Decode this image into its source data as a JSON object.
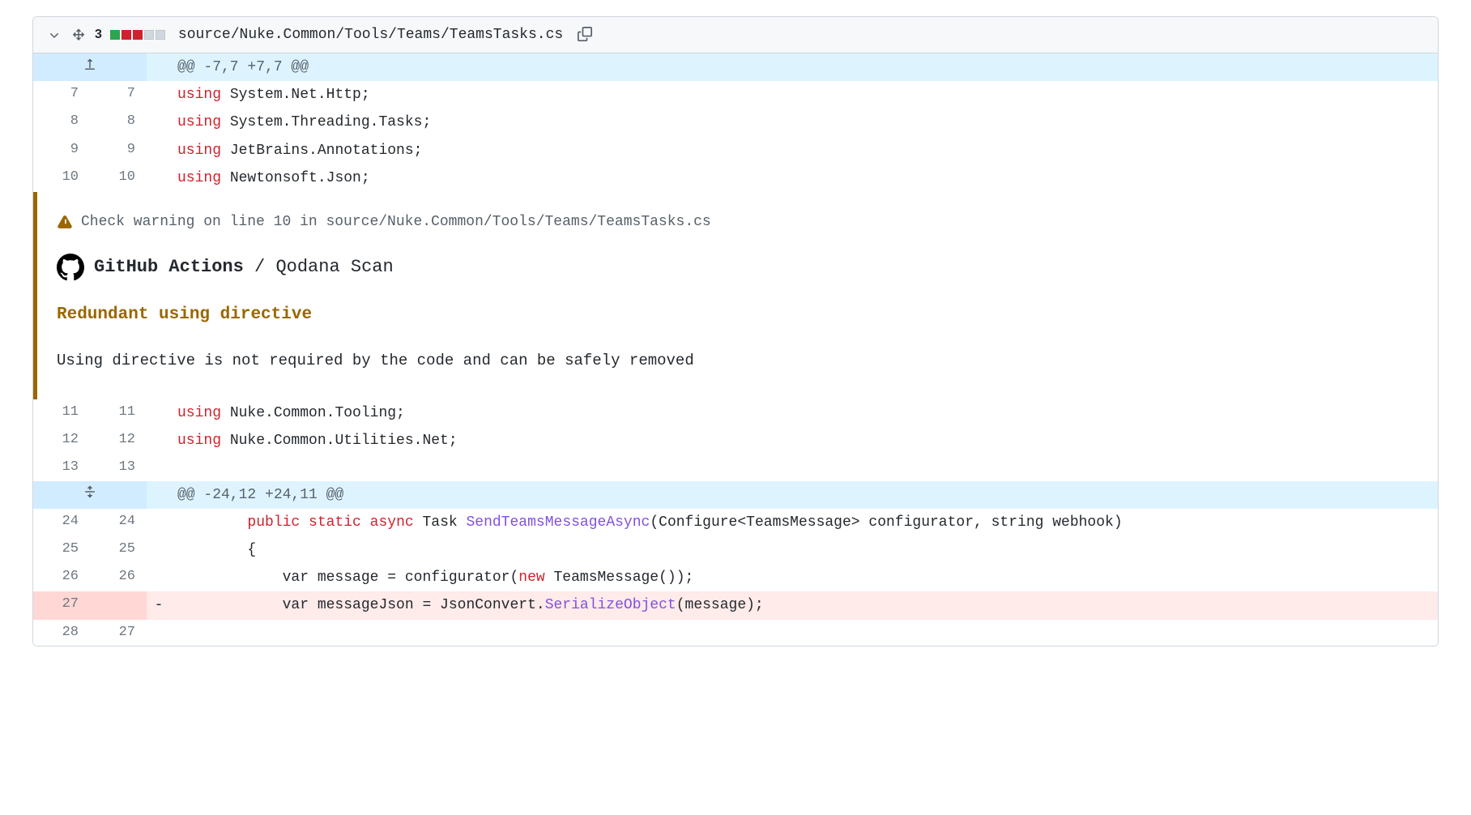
{
  "file": {
    "change_count": "3",
    "path": "source/Nuke.Common/Tools/Teams/TeamsTasks.cs",
    "diffstat": [
      "add",
      "del",
      "del",
      "neutral",
      "neutral"
    ]
  },
  "hunks": {
    "h1": "@@ -7,7 +7,7 @@",
    "h2": "@@ -24,12 +24,11 @@"
  },
  "lines": {
    "l7_old": "7",
    "l7_new": "7",
    "l8_old": "8",
    "l8_new": "8",
    "l9_old": "9",
    "l9_new": "9",
    "l10_old": "10",
    "l10_new": "10",
    "l11_old": "11",
    "l11_new": "11",
    "l12_old": "12",
    "l12_new": "12",
    "l13_old": "13",
    "l13_new": "13",
    "l24_old": "24",
    "l24_new": "24",
    "l25_old": "25",
    "l25_new": "25",
    "l26_old": "26",
    "l26_new": "26",
    "l27d_old": "27",
    "l28_old": "28",
    "l28_new": "27"
  },
  "code": {
    "using": "using",
    "public": "public",
    "static": "static",
    "async": "async",
    "new_kw": "new",
    "l7_rest": " System.Net.Http;",
    "l8_rest": " System.Threading.Tasks;",
    "l9_rest": " JetBrains.Annotations;",
    "l10_rest": " Newtonsoft.Json;",
    "l11_rest": " Nuke.Common.Tooling;",
    "l12_rest": " Nuke.Common.Utilities.Net;",
    "l13_rest": "",
    "l24_pre": "        ",
    "l24_task": " Task ",
    "l24_method": "SendTeamsMessageAsync",
    "l24_post": "(Configure<TeamsMessage> configurator, string webhook)",
    "l25": "        {",
    "l26_pre": "            var message = configurator(",
    "l26_post": " TeamsMessage());",
    "l27_pre": "            var messageJson = JsonConvert.",
    "l27_method": "SerializeObject",
    "l27_post": "(message);",
    "l28": ""
  },
  "annotation": {
    "warning_text": "Check warning on line 10 in source/Nuke.Common/Tools/Teams/TeamsTasks.cs",
    "source_bold": "GitHub Actions",
    "source_sep": " / ",
    "source_rest": "Qodana Scan",
    "title": "Redundant using directive",
    "body": "Using directive is not required by the code and can be safely removed"
  },
  "markers": {
    "minus": "-"
  }
}
